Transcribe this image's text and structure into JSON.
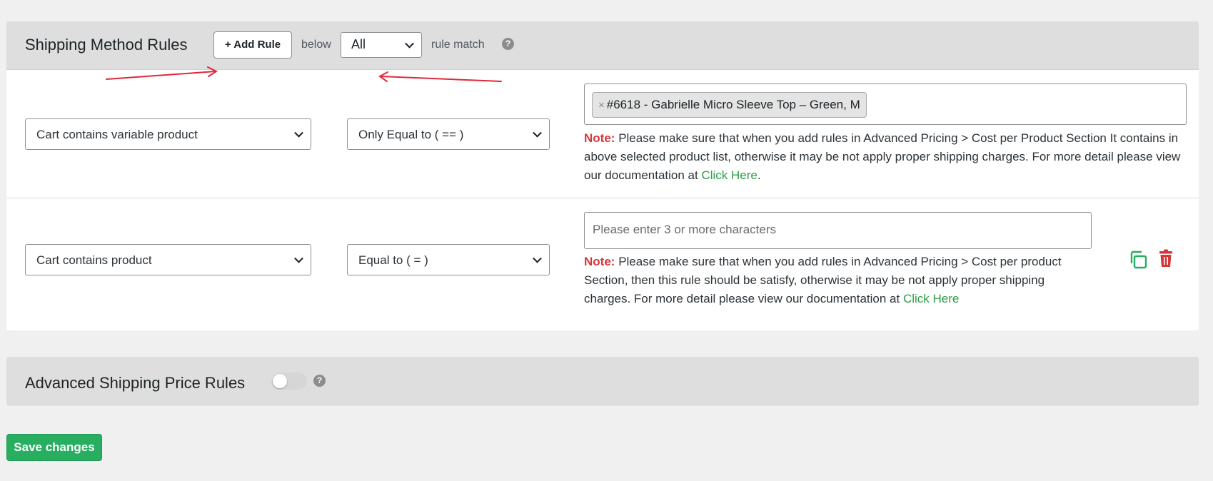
{
  "shipping_rules": {
    "title": "Shipping Method Rules",
    "add_rule_label": "+ Add Rule",
    "below_text": "below",
    "match_value": "All",
    "rule_match_text": "rule match",
    "help_icon": "?"
  },
  "rules": [
    {
      "condition": "Cart contains variable product",
      "operator": "Only Equal to ( == )",
      "token_remove": "×",
      "token": "#6618 - Gabrielle Micro Sleeve Top – Green, M",
      "note_label": "Note:",
      "note_text": "Please make sure that when you add rules in Advanced Pricing > Cost per Product Section It contains in above selected product list, otherwise it may be not apply proper shipping charges. For more detail please view our documentation at",
      "note_link": "Click Here",
      "note_suffix": "."
    },
    {
      "condition": "Cart contains product",
      "operator": "Equal to ( = )",
      "placeholder": "Please enter 3 or more characters",
      "note_label": "Note:",
      "note_text": "Please make sure that when you add rules in Advanced Pricing > Cost per product Section, then this rule should be satisfy, otherwise it may be not apply proper shipping charges. For more detail please view our documentation at",
      "note_link": "Click Here"
    }
  ],
  "advanced_rules": {
    "title": "Advanced Shipping Price Rules",
    "toggle_on": false,
    "help_icon": "?"
  },
  "save_label": "Save changes",
  "colors": {
    "note_red": "#d63638",
    "link_green": "#2b9d47",
    "save_green": "#27ae60",
    "delete_red": "#d63638",
    "annotation_red": "#e0283c"
  },
  "icons": [
    "help-icon",
    "chevron-down-icon",
    "remove-token-icon",
    "duplicate-icon",
    "trash-icon",
    "annotation-arrow"
  ]
}
